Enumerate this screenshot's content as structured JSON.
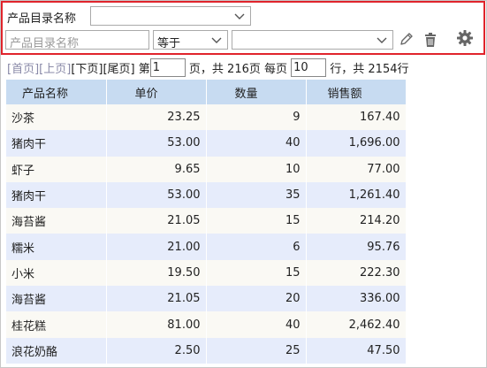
{
  "filter": {
    "name_label": "产品目录名称",
    "name_select_value": "",
    "field_placeholder": "产品目录名称",
    "operator_value": "等于",
    "value_select_value": ""
  },
  "pager": {
    "first": "[首页]",
    "prev": "[上页]",
    "next": "[下页]",
    "last": "[尾页]",
    "page_prefix": "第",
    "current_page": "1",
    "page_suffix": "页，共 216页 每页",
    "page_size": "10",
    "rows_suffix": "行，共 2154行"
  },
  "table": {
    "headers": [
      "产品名称",
      "单价",
      "数量",
      "销售额"
    ],
    "rows": [
      {
        "name": "沙茶",
        "price": "23.25",
        "qty": "9",
        "sales": "167.40"
      },
      {
        "name": "猪肉干",
        "price": "53.00",
        "qty": "40",
        "sales": "1,696.00"
      },
      {
        "name": "虾子",
        "price": "9.65",
        "qty": "10",
        "sales": "77.00"
      },
      {
        "name": "猪肉干",
        "price": "53.00",
        "qty": "35",
        "sales": "1,261.40"
      },
      {
        "name": "海苔酱",
        "price": "21.05",
        "qty": "15",
        "sales": "214.20"
      },
      {
        "name": "糯米",
        "price": "21.00",
        "qty": "6",
        "sales": "95.76"
      },
      {
        "name": "小米",
        "price": "19.50",
        "qty": "15",
        "sales": "222.30"
      },
      {
        "name": "海苔酱",
        "price": "21.05",
        "qty": "20",
        "sales": "336.00"
      },
      {
        "name": "桂花糕",
        "price": "81.00",
        "qty": "40",
        "sales": "2,462.40"
      },
      {
        "name": "浪花奶酪",
        "price": "2.50",
        "qty": "25",
        "sales": "47.50"
      }
    ]
  },
  "colors": {
    "highlight_border": "#e0242c",
    "header_bg": "#c7dbf1",
    "row_odd_bg": "#faf9f4",
    "row_even_bg": "#e6ecfb"
  },
  "icons": [
    "chevron-down-icon",
    "pencil-icon",
    "trash-icon",
    "gear-icon"
  ]
}
